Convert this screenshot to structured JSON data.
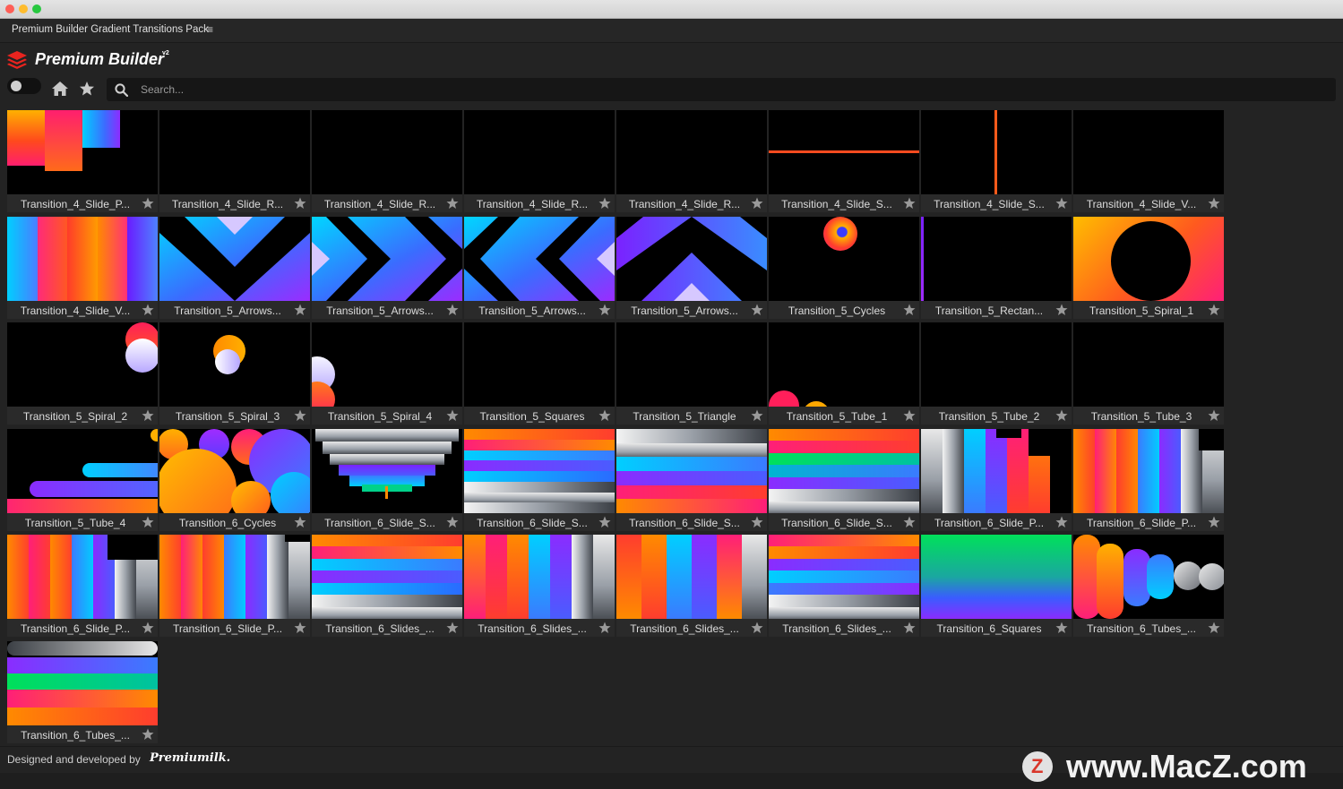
{
  "window": {
    "title": "Premium Builder Gradient Transitions Pack",
    "menu_icon": "hamburger-icon"
  },
  "brand": {
    "name": "Premium Builder",
    "version": "v2",
    "logo_color": "#e8241f"
  },
  "toolbar": {
    "home_icon": "home-icon",
    "favorites_icon": "star-icon",
    "toggle_state": "off"
  },
  "search": {
    "placeholder": "Search...",
    "value": ""
  },
  "colors": {
    "accent": "#2f7bd6",
    "background": "#232323",
    "tile_label_bg": "#2a2a2a"
  },
  "items": [
    {
      "label": "Transition_4_Slide_P...",
      "thumb": "slide-push"
    },
    {
      "label": "Transition_4_Slide_R...",
      "thumb": "dark"
    },
    {
      "label": "Transition_4_Slide_R...",
      "thumb": "dark"
    },
    {
      "label": "Transition_4_Slide_R...",
      "thumb": "dark"
    },
    {
      "label": "Transition_4_Slide_R...",
      "thumb": "dark"
    },
    {
      "label": "Transition_4_Slide_S...",
      "thumb": "hline"
    },
    {
      "label": "Transition_4_Slide_S...",
      "thumb": "vline"
    },
    {
      "label": "Transition_4_Slide_V...",
      "thumb": "dark"
    },
    {
      "label": "Transition_4_Slide_V...",
      "thumb": "vbands"
    },
    {
      "label": "Transition_5_Arrows...",
      "thumb": "arrow-down"
    },
    {
      "label": "Transition_5_Arrows...",
      "thumb": "arrow-right"
    },
    {
      "label": "Transition_5_Arrows...",
      "thumb": "arrow-left"
    },
    {
      "label": "Transition_5_Arrows...",
      "thumb": "arrow-up"
    },
    {
      "label": "Transition_5_Cycles",
      "thumb": "cycles"
    },
    {
      "label": "Transition_5_Rectan...",
      "thumb": "rect-edges"
    },
    {
      "label": "Transition_5_Spiral_1",
      "thumb": "spiral-1"
    },
    {
      "label": "Transition_5_Spiral_2",
      "thumb": "spiral-2"
    },
    {
      "label": "Transition_5_Spiral_3",
      "thumb": "spiral-3"
    },
    {
      "label": "Transition_5_Spiral_4",
      "thumb": "spiral-4"
    },
    {
      "label": "Transition_5_Squares",
      "thumb": "dark"
    },
    {
      "label": "Transition_5_Triangle",
      "thumb": "dark"
    },
    {
      "label": "Transition_5_Tube_1",
      "thumb": "tube-1"
    },
    {
      "label": "Transition_5_Tube_2",
      "thumb": "dark"
    },
    {
      "label": "Transition_5_Tube_3",
      "thumb": "dark"
    },
    {
      "label": "Transition_5_Tube_4",
      "thumb": "tube-4"
    },
    {
      "label": "Transition_6_Cycles",
      "thumb": "cycles-6"
    },
    {
      "label": "Transition_6_Slide_S...",
      "thumb": "funnel"
    },
    {
      "label": "Transition_6_Slide_S...",
      "thumb": "hstripes-a"
    },
    {
      "label": "Transition_6_Slide_S...",
      "thumb": "hstripes-b"
    },
    {
      "label": "Transition_6_Slide_S...",
      "thumb": "hstripes-c"
    },
    {
      "label": "Transition_6_Slide_P...",
      "thumb": "vstripes-a"
    },
    {
      "label": "Transition_6_Slide_P...",
      "thumb": "vstripes-b"
    },
    {
      "label": "Transition_6_Slide_P...",
      "thumb": "vstripes-c"
    },
    {
      "label": "Transition_6_Slide_P...",
      "thumb": "vstripes-d"
    },
    {
      "label": "Transition_6_Slides_...",
      "thumb": "hstripes-d"
    },
    {
      "label": "Transition_6_Slides_...",
      "thumb": "vstripes-e"
    },
    {
      "label": "Transition_6_Slides_...",
      "thumb": "vstripes-f"
    },
    {
      "label": "Transition_6_Slides_...",
      "thumb": "hstripes-e"
    },
    {
      "label": "Transition_6_Squares",
      "thumb": "squares-6"
    },
    {
      "label": "Transition_6_Tubes_...",
      "thumb": "tubes-h"
    },
    {
      "label": "Transition_6_Tubes_...",
      "thumb": "tubes-pills"
    }
  ],
  "selected_index": 11,
  "footer": {
    "text": "Designed and developed by",
    "brand": "Premiumilk."
  },
  "watermark": {
    "letter": "Z",
    "text": "www.MacZ.com"
  }
}
